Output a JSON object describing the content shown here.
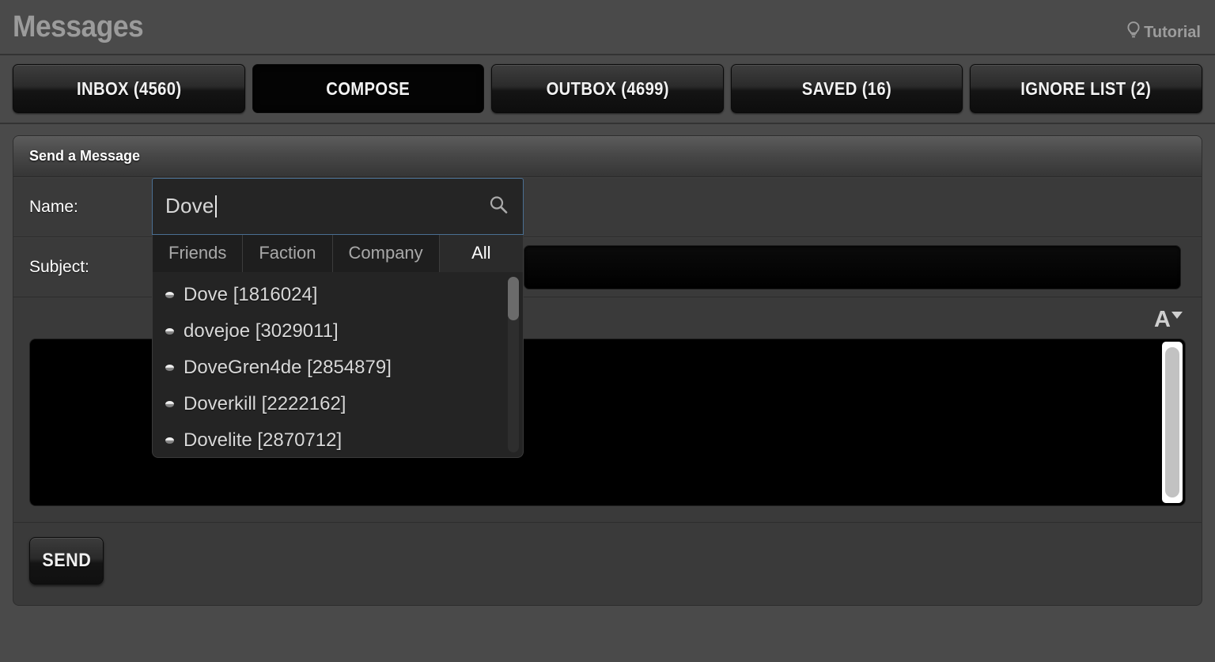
{
  "header": {
    "title": "Messages",
    "tutorial_label": "Tutorial",
    "tutorial_icon": "lightbulb-icon"
  },
  "tabs": [
    {
      "label": "INBOX (4560)",
      "active": false
    },
    {
      "label": "COMPOSE",
      "active": true
    },
    {
      "label": "OUTBOX (4699)",
      "active": false
    },
    {
      "label": "SAVED (16)",
      "active": false
    },
    {
      "label": "IGNORE LIST (2)",
      "active": false
    }
  ],
  "panel": {
    "title": "Send a Message",
    "name_label": "Name:",
    "subject_label": "Subject:",
    "subject_value": "",
    "body_value": "",
    "send_label": "SEND"
  },
  "autocomplete": {
    "query": "Dove",
    "search_icon": "search-icon",
    "filters": [
      {
        "label": "Friends",
        "active": false
      },
      {
        "label": "Faction",
        "active": false
      },
      {
        "label": "Company",
        "active": false
      },
      {
        "label": "All",
        "active": true
      }
    ],
    "suggestions": [
      {
        "name": "Dove",
        "id": "1816024",
        "text": "Dove [1816024]"
      },
      {
        "name": "dovejoe",
        "id": "3029011",
        "text": "dovejoe [3029011]"
      },
      {
        "name": "DoveGren4de",
        "id": "2854879",
        "text": "DoveGren4de [2854879]"
      },
      {
        "name": "Doverkill",
        "id": "2222162",
        "text": "Doverkill [2222162]"
      },
      {
        "name": "Dovelite",
        "id": "2870712",
        "text": "Dovelite [2870712]"
      }
    ]
  },
  "editor": {
    "font_tool_icon": "font-size-icon"
  },
  "colors": {
    "page_bg": "#4a4a4a",
    "panel_bg": "#3a3a3a",
    "focus_border": "#4a6f92",
    "active_tab_bg": "#040404"
  }
}
